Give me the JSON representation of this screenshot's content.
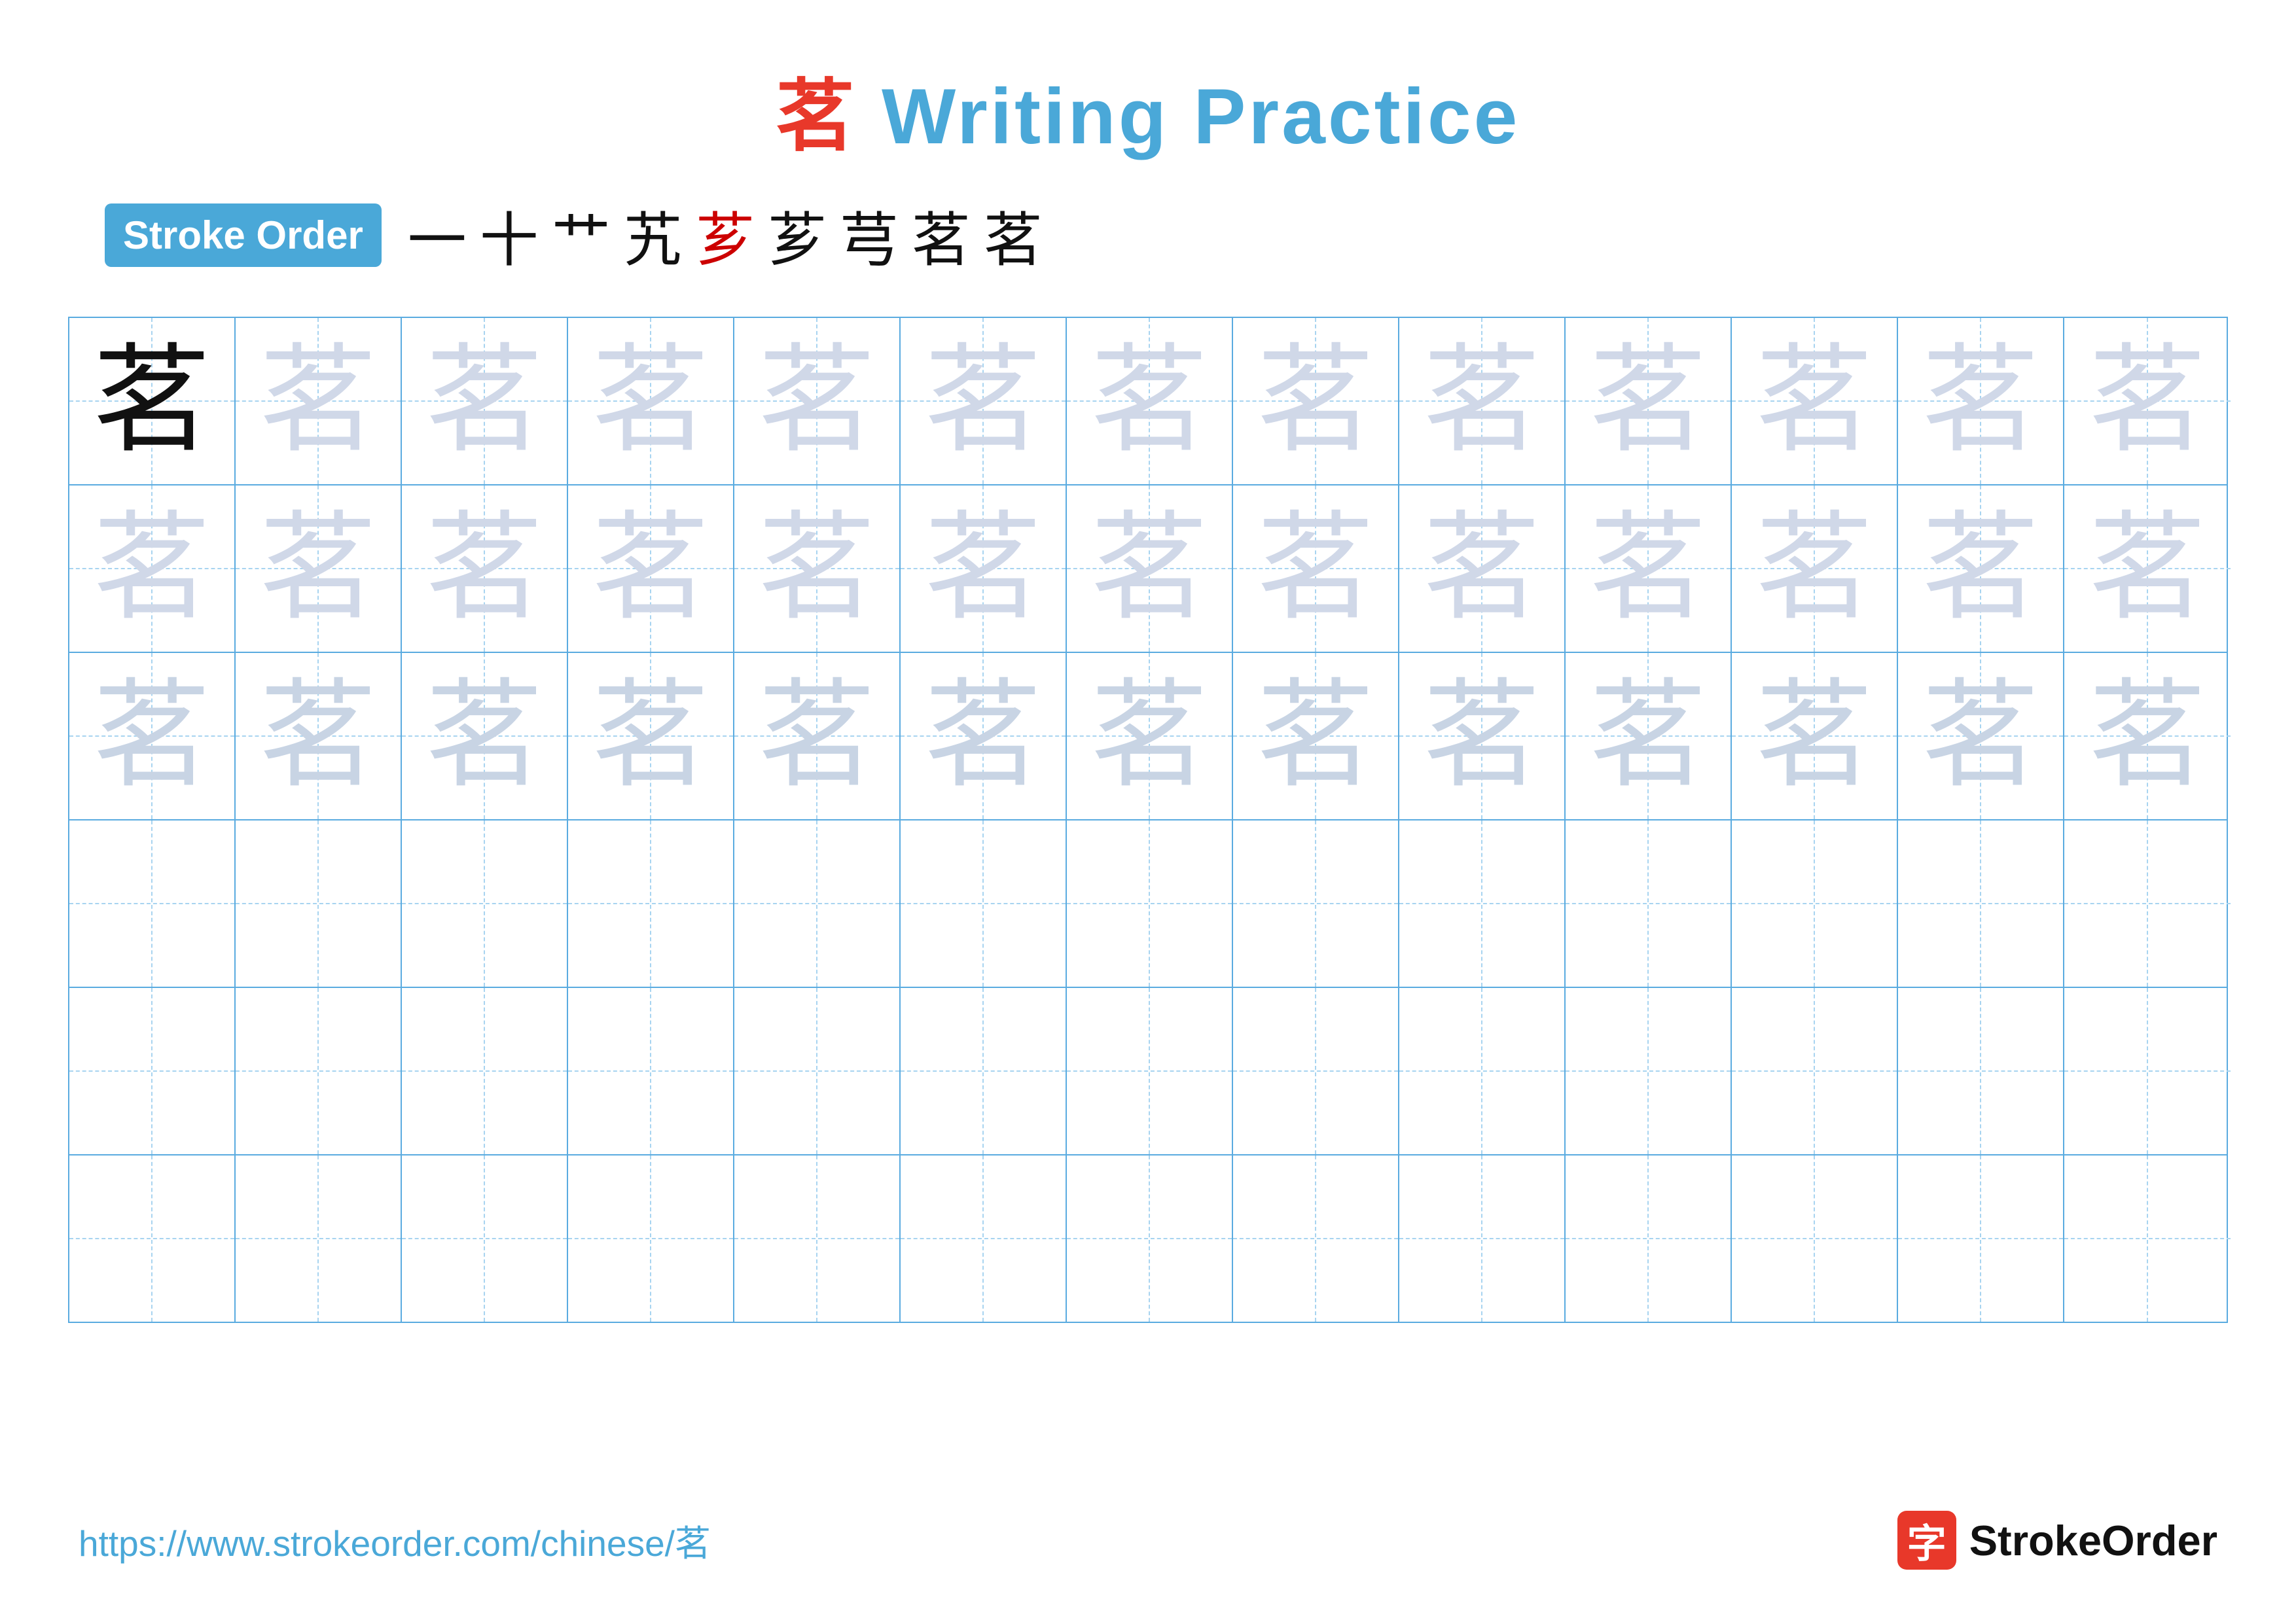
{
  "title": {
    "char": "茗",
    "rest": " Writing Practice"
  },
  "stroke_order": {
    "badge": "Stroke Order",
    "strokes": [
      "一",
      "十",
      "艹",
      "艽",
      "芗",
      "芗",
      "芎",
      "茗",
      "茗"
    ],
    "red_index": 4
  },
  "grid": {
    "rows": 6,
    "cols": 13,
    "char": "茗",
    "filled_rows": [
      {
        "type": "first",
        "first_dark": true,
        "rest_light": true
      },
      {
        "type": "light"
      },
      {
        "type": "lighter"
      },
      {
        "type": "empty"
      },
      {
        "type": "empty"
      },
      {
        "type": "empty"
      }
    ]
  },
  "footer": {
    "url": "https://www.strokeorder.com/chinese/茗",
    "brand_name": "StrokeOrder",
    "brand_char": "字"
  }
}
